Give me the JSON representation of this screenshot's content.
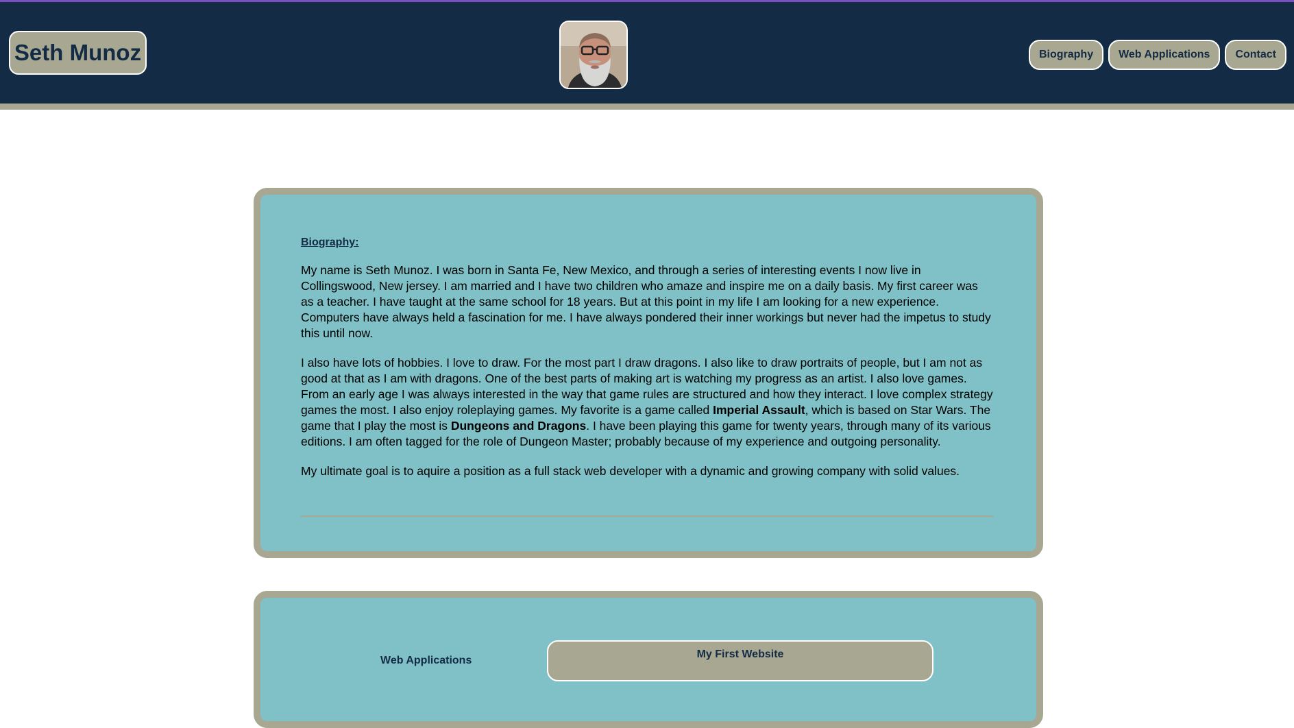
{
  "header": {
    "name": "Seth Munoz",
    "nav": [
      "Biography",
      "Web Applications",
      "Contact"
    ]
  },
  "bio": {
    "heading": "Biography:",
    "p1": "My name is Seth Munoz. I was born in Santa Fe, New Mexico, and through a series of interesting events I now live in Collingswood, New jersey. I am married and I have two children who amaze and inspire me on a daily basis. My first career was as a teacher. I have taught at the same school for 18 years. But at this point in my life I am looking for a new experience. Computers have always held a fascination for me. I have always pondered their inner workings but never had the impetus to study this until now.",
    "p2_a": "I also have lots of hobbies. I love to draw. For the most part I draw dragons. I also like to draw portraits of people, but I am not as good at that as I am with dragons. One of the best parts of making art is watching my progress as an artist. I also love games. From an early age I was always interested in the way that game rules are structured and how they interact. I love complex strategy games the most. I also enjoy roleplaying games. My favorite is a game called ",
    "p2_b1": "Imperial Assault",
    "p2_c": ", which is based on Star Wars. The game that I play the most is ",
    "p2_b2": "Dungeons and Dragons",
    "p2_d": ". I have been playing this game for twenty years, through many of its various editions. I am often tagged for the role of Dungeon Master; probably because of my experience and outgoing personality.",
    "p3": "My ultimate goal is to aquire a position as a full stack web developer with a dynamic and growing company with solid values."
  },
  "webapps": {
    "heading": "Web Applications",
    "project_title": "My First Website"
  },
  "colors": {
    "navy": "#142b45",
    "khaki": "#a8a892",
    "teal": "#7fc1c7",
    "accent": "#7a4fc0"
  }
}
